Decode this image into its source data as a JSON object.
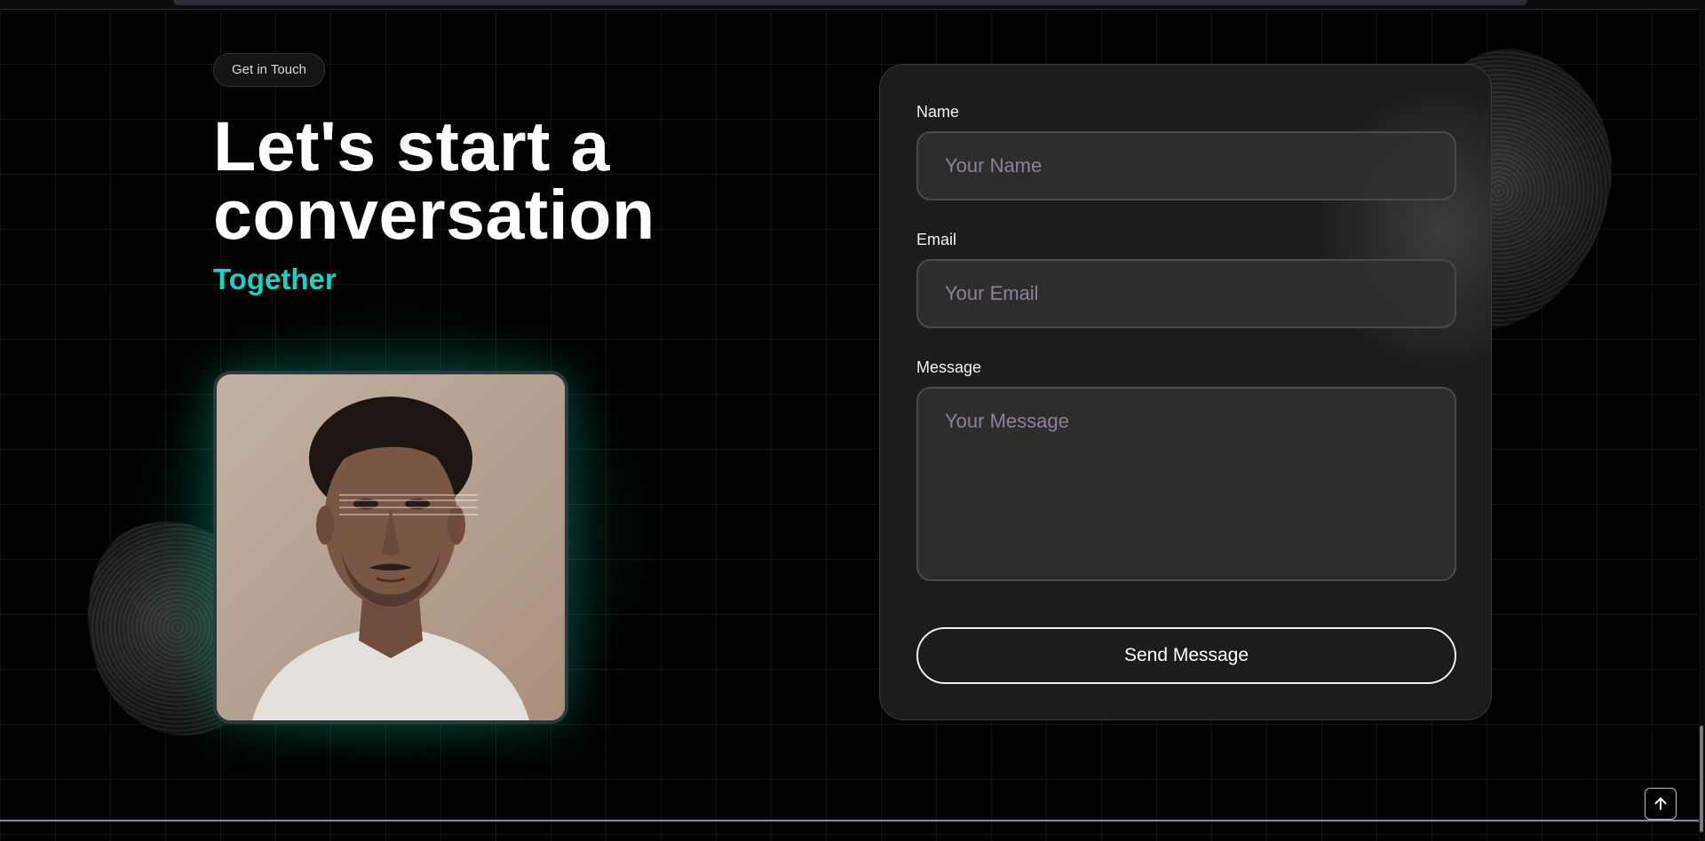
{
  "hero": {
    "badge": "Get in Touch",
    "headline": "Let's start a conversation",
    "subheadline": "Together",
    "accent_color": "#1bd1c4"
  },
  "form": {
    "name_label": "Name",
    "name_placeholder": "Your Name",
    "email_label": "Email",
    "email_placeholder": "Your Email",
    "message_label": "Message",
    "message_placeholder": "Your Message",
    "submit_label": "Send Message"
  },
  "icons": {
    "back_to_top": "arrow-up-icon"
  },
  "colors": {
    "background": "#000000",
    "card": "#1c1c1c",
    "placeholder": "#8d809a"
  }
}
